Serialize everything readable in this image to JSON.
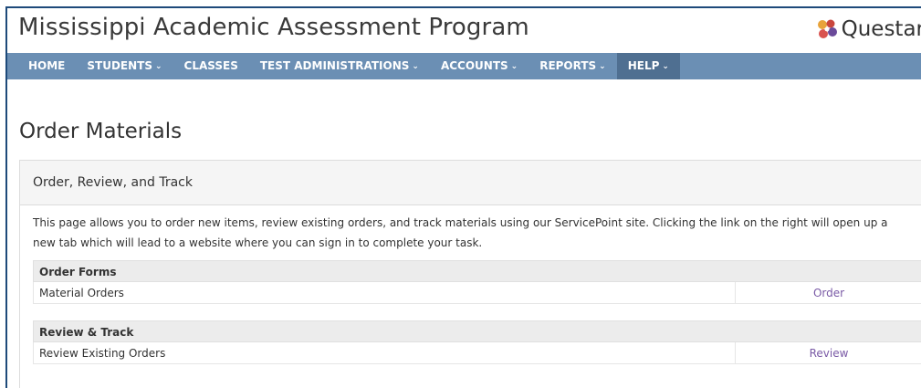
{
  "app": {
    "title": "Mississippi Academic Assessment Program",
    "logo_text": "Questar"
  },
  "nav": {
    "items": [
      {
        "label": "HOME",
        "has_menu": false
      },
      {
        "label": "STUDENTS",
        "has_menu": true
      },
      {
        "label": "CLASSES",
        "has_menu": false
      },
      {
        "label": "TEST ADMINISTRATIONS",
        "has_menu": true
      },
      {
        "label": "ACCOUNTS",
        "has_menu": true
      },
      {
        "label": "REPORTS",
        "has_menu": true
      },
      {
        "label": "HELP",
        "has_menu": true,
        "active": true
      }
    ],
    "chevron": "⌄"
  },
  "page": {
    "title": "Order Materials",
    "panel_heading": "Order, Review, and Track",
    "intro": "This page allows you to order new items, review existing orders, and track materials using our ServicePoint site. Clicking the link on the right will open up a new tab which will lead to a website where you can sign in to complete your task."
  },
  "sections": [
    {
      "header": "Order Forms",
      "rows": [
        {
          "label": "Material Orders",
          "link": "Order"
        }
      ]
    },
    {
      "header": "Review & Track",
      "rows": [
        {
          "label": "Review Existing Orders",
          "link": "Review"
        }
      ]
    }
  ],
  "colors": {
    "nav_bg": "#6b8fb4",
    "nav_active": "#4f6f91",
    "link": "#7a5aa6",
    "frame": "#1e4a7a"
  },
  "icons": {
    "logo": "questar-pinwheel-icon",
    "menu_caret": "chevron-down-icon"
  }
}
